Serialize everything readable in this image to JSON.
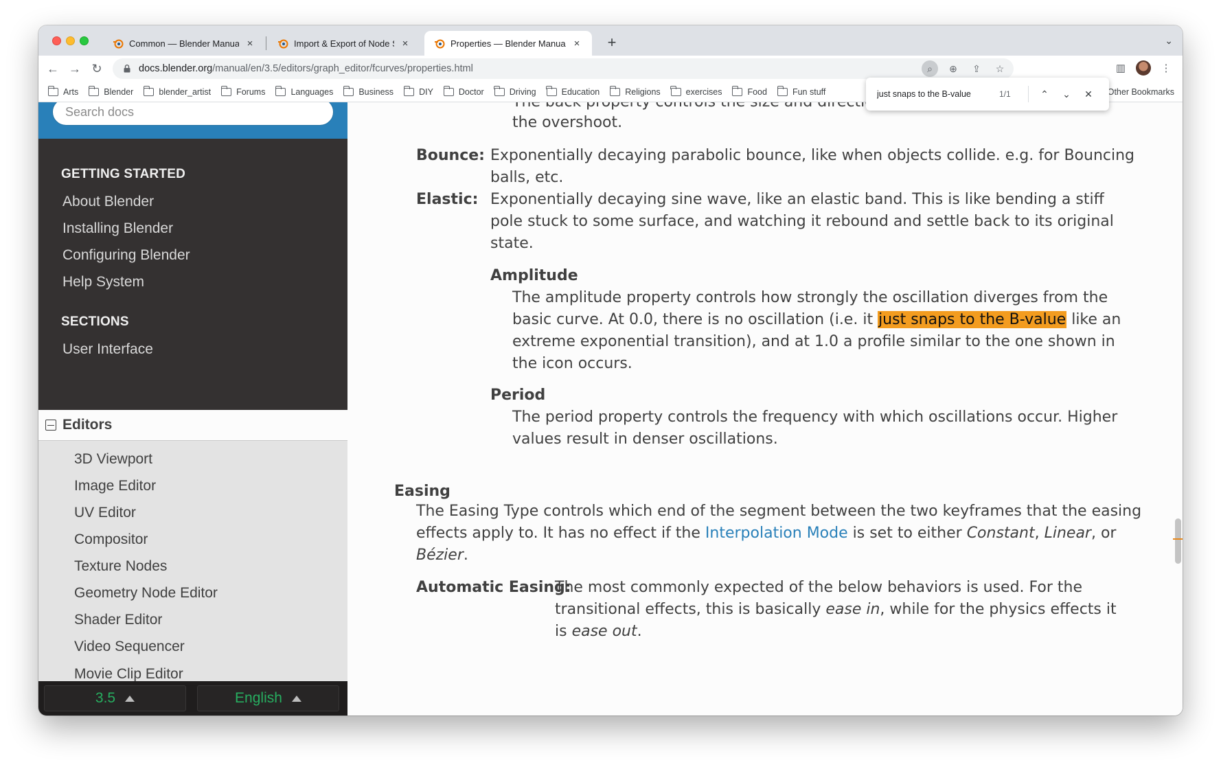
{
  "tabs": [
    {
      "title": "Common — Blender Manual",
      "active": false
    },
    {
      "title": "Import & Export of Node Shade",
      "active": false
    },
    {
      "title": "Properties — Blender Manual",
      "active": true
    }
  ],
  "address": {
    "host": "docs.blender.org",
    "path": "/manual/en/3.5/editors/graph_editor/fcurves/properties.html"
  },
  "bookmarks": [
    "Arts",
    "Blender",
    "blender_artist",
    "Forums",
    "Languages",
    "Business",
    "DIY",
    "Doctor",
    "Driving",
    "Education",
    "Religions",
    "exercises",
    "Food",
    "Fun stuff"
  ],
  "other_bookmarks": "Other Bookmarks",
  "find": {
    "query": "just snaps to the B-value",
    "count": "1/1"
  },
  "sidebar": {
    "search_placeholder": "Search docs",
    "getting_started_caption": "GETTING STARTED",
    "getting_started": [
      "About Blender",
      "Installing Blender",
      "Configuring Blender",
      "Help System"
    ],
    "sections_caption": "SECTIONS",
    "sections": [
      "User Interface"
    ],
    "current": "Editors",
    "editors": [
      "3D Viewport",
      "Image Editor",
      "UV Editor",
      "Compositor",
      "Texture Nodes",
      "Geometry Node Editor",
      "Shader Editor",
      "Video Sequencer",
      "Movie Clip Editor"
    ],
    "version": "3.5",
    "language": "English"
  },
  "content": {
    "top_cut": "The back property controls the size and direction of",
    "top_line": "the overshoot.",
    "bounce_term": "Bounce:",
    "bounce_l1": "Exponentially decaying parabolic bounce, like when objects collide. e.g. for Bouncing",
    "bounce_l2": "balls, etc.",
    "elastic_term": "Elastic:",
    "elastic_l1": "Exponentially decaying sine wave, like an elastic band. This is like bending a stiff",
    "elastic_l2": "pole stuck to some surface, and watching it rebound and settle back to its original",
    "elastic_l3": "state.",
    "amplitude_term": "Amplitude",
    "amp_l1": "The amplitude property controls how strongly the oscillation diverges from the",
    "amp_l2_pre": "basic curve. At 0.0, there is no oscillation (i.e. it ",
    "amp_l2_hl": "just snaps to the B-value",
    "amp_l2_post": " like an",
    "amp_l3": "extreme exponential transition), and at 1.0 a profile similar to the one shown in",
    "amp_l4": "the icon occurs.",
    "period_term": "Period",
    "per_l1": "The period property controls the frequency with which oscillations occur. Higher",
    "per_l2": "values result in denser oscillations.",
    "easing_term": "Easing",
    "eas_l1": "The Easing Type controls which end of the segment between the two keyframes that the easing",
    "eas_l2_pre": "effects apply to. It has no effect if the ",
    "eas_l2_link": "Interpolation Mode",
    "eas_l2_mid": " is set to either ",
    "eas_constant": "Constant",
    "eas_comma": ", ",
    "eas_linear": "Linear",
    "eas_or": ", or",
    "eas_bezier": "Bézier",
    "eas_period": ".",
    "auto_term": "Automatic Easing:",
    "auto_l1": "The most commonly expected of the below behaviors is used. For the",
    "auto_l2_pre": "transitional effects, this is basically ",
    "auto_ease_in": "ease in",
    "auto_l2_post": ", while for the physics effects it",
    "auto_l3_pre": "is ",
    "auto_ease_out": "ease out",
    "auto_l3_post": "."
  }
}
